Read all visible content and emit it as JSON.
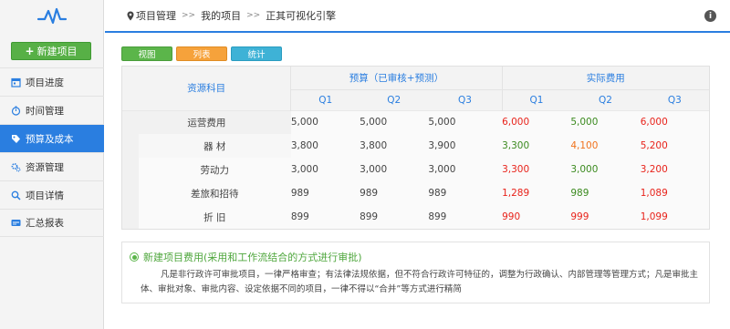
{
  "sidebar": {
    "new_button": "新建项目",
    "items": [
      {
        "label": "项目进度",
        "icon": "calendar-icon"
      },
      {
        "label": "时间管理",
        "icon": "stopwatch-icon"
      },
      {
        "label": "预算及成本",
        "icon": "tag-icon",
        "active": true
      },
      {
        "label": "资源管理",
        "icon": "gears-icon"
      },
      {
        "label": "项目详情",
        "icon": "search-icon"
      },
      {
        "label": "汇总报表",
        "icon": "card-icon"
      }
    ]
  },
  "header": {
    "crumbs": [
      "项目管理",
      "我的项目",
      "正其可视化引擎"
    ],
    "separator": ">>"
  },
  "tabs": [
    "视图",
    "列表",
    "统计"
  ],
  "table": {
    "source_header": "资源科目",
    "budget_header": "预算（已审核+预测）",
    "actual_header": "实际费用",
    "quarters": [
      "Q1",
      "Q2",
      "Q3",
      "Q1",
      "Q2",
      "Q3"
    ],
    "rows": [
      {
        "name": "运营费用",
        "budget": [
          "5,000",
          "5,000",
          "5,000"
        ],
        "actual": [
          "6,000",
          "5,000",
          "6,000"
        ],
        "actual_colors": [
          "red",
          "green",
          "red"
        ]
      },
      {
        "name": "器 材",
        "budget": [
          "3,800",
          "3,800",
          "3,900"
        ],
        "actual": [
          "3,300",
          "4,100",
          "5,200"
        ],
        "actual_colors": [
          "green",
          "orange",
          "red"
        ]
      },
      {
        "name": "劳动力",
        "budget": [
          "3,000",
          "3,000",
          "3,000"
        ],
        "actual": [
          "3,300",
          "3,000",
          "3,200"
        ],
        "actual_colors": [
          "red",
          "green",
          "red"
        ]
      },
      {
        "name": "差旅和招待",
        "budget": [
          "989",
          "989",
          "989"
        ],
        "actual": [
          "1,289",
          "989",
          "1,089"
        ],
        "actual_colors": [
          "red",
          "green",
          "red"
        ]
      },
      {
        "name": "折 旧",
        "budget": [
          "899",
          "899",
          "899"
        ],
        "actual": [
          "990",
          "999",
          "1,099"
        ],
        "actual_colors": [
          "red",
          "red",
          "red"
        ]
      }
    ]
  },
  "note": {
    "title": "新建项目费用(采用和工作流结合的方式进行审批)",
    "body": "凡是非行政许可审批项目，一律严格审查；有法律法规依据，但不符合行政许可特征的，调整为行政确认、内部管理等管理方式；凡是审批主体、审批对象、审批内容、设定依据不同的项目，一律不得以“合并”等方式进行精简"
  },
  "colors": {
    "accent": "#2a7ee0",
    "green": "#5bb54a",
    "red": "#e8231b",
    "orange": "#f0721c"
  }
}
